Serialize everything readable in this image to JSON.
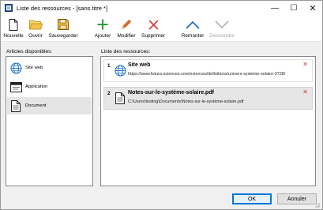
{
  "window": {
    "title": "Liste des ressources - [sans titre *]",
    "minimize_glyph": "—",
    "maximize_glyph": "☐",
    "close_glyph": "✕"
  },
  "toolbar": {
    "nouvelle": "Nouvelle",
    "ouvrir": "Ouvrir",
    "sauvegarder": "Sauvegarder",
    "ajouter": "Ajouter",
    "modifier": "Modifier",
    "supprimer": "Supprimer",
    "remonter": "Remonter",
    "descendre": "Descendre"
  },
  "articles": {
    "label": "Articles disponibles:",
    "items": [
      {
        "label": "Site web",
        "icon": "globe-icon"
      },
      {
        "label": "Application",
        "icon": "application-window-icon"
      },
      {
        "label": "Document",
        "icon": "document-icon"
      }
    ],
    "selected_index": 2
  },
  "resources": {
    "label": "Liste des ressources:",
    "items": [
      {
        "num": "1",
        "title": "Site web",
        "subtitle": "https://www.futura-sciences.com/sciences/definitions/univers-systeme-solaire-3728/",
        "icon": "globe-icon",
        "remove": "✕"
      },
      {
        "num": "2",
        "title": "Notes-sur-le-système-solaire.pdf",
        "subtitle": "C:\\Users\\testing\\Documents\\Notes-sur-le-système-solaire.pdf",
        "icon": "document-icon",
        "remove": "✕"
      }
    ],
    "selected_index": 1
  },
  "footer": {
    "ok": "OK",
    "annuler": "Annuler"
  },
  "colors": {
    "accent": "#0078d7",
    "globe": "#1a6fc4",
    "folder": "#f2c14e",
    "save": "#d9a21f",
    "add": "#2e9c3a",
    "edit": "#e8742c",
    "delete": "#d23c3c",
    "move_up": "#1f6ec3",
    "disabled": "#b5b5b5"
  }
}
